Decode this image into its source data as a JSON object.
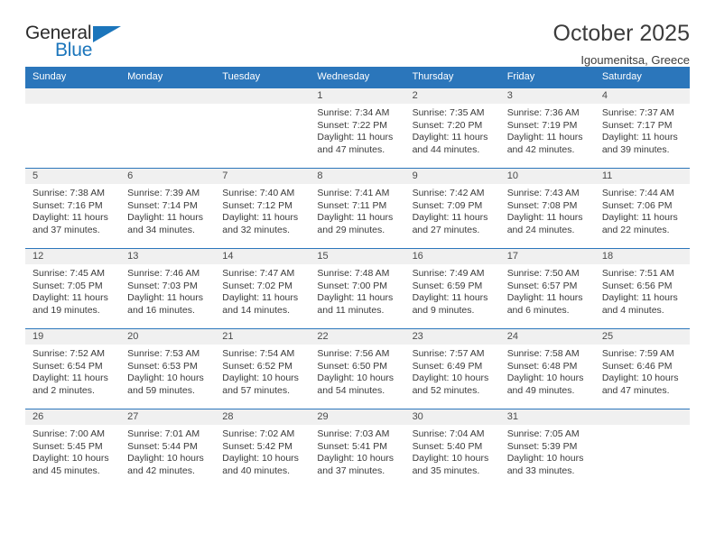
{
  "logo": {
    "word_top": "General",
    "word_bottom": "Blue",
    "accent_color": "#1b75bb"
  },
  "header": {
    "title": "October 2025",
    "subtitle": "Igoumenitsa, Greece"
  },
  "calendar": {
    "header_color": "#2b76bb",
    "weekdays": [
      "Sunday",
      "Monday",
      "Tuesday",
      "Wednesday",
      "Thursday",
      "Friday",
      "Saturday"
    ],
    "weeks": [
      [
        {
          "day": "",
          "sunrise": "",
          "sunset": "",
          "daylight": ""
        },
        {
          "day": "",
          "sunrise": "",
          "sunset": "",
          "daylight": ""
        },
        {
          "day": "",
          "sunrise": "",
          "sunset": "",
          "daylight": ""
        },
        {
          "day": "1",
          "sunrise": "Sunrise: 7:34 AM",
          "sunset": "Sunset: 7:22 PM",
          "daylight": "Daylight: 11 hours and 47 minutes."
        },
        {
          "day": "2",
          "sunrise": "Sunrise: 7:35 AM",
          "sunset": "Sunset: 7:20 PM",
          "daylight": "Daylight: 11 hours and 44 minutes."
        },
        {
          "day": "3",
          "sunrise": "Sunrise: 7:36 AM",
          "sunset": "Sunset: 7:19 PM",
          "daylight": "Daylight: 11 hours and 42 minutes."
        },
        {
          "day": "4",
          "sunrise": "Sunrise: 7:37 AM",
          "sunset": "Sunset: 7:17 PM",
          "daylight": "Daylight: 11 hours and 39 minutes."
        }
      ],
      [
        {
          "day": "5",
          "sunrise": "Sunrise: 7:38 AM",
          "sunset": "Sunset: 7:16 PM",
          "daylight": "Daylight: 11 hours and 37 minutes."
        },
        {
          "day": "6",
          "sunrise": "Sunrise: 7:39 AM",
          "sunset": "Sunset: 7:14 PM",
          "daylight": "Daylight: 11 hours and 34 minutes."
        },
        {
          "day": "7",
          "sunrise": "Sunrise: 7:40 AM",
          "sunset": "Sunset: 7:12 PM",
          "daylight": "Daylight: 11 hours and 32 minutes."
        },
        {
          "day": "8",
          "sunrise": "Sunrise: 7:41 AM",
          "sunset": "Sunset: 7:11 PM",
          "daylight": "Daylight: 11 hours and 29 minutes."
        },
        {
          "day": "9",
          "sunrise": "Sunrise: 7:42 AM",
          "sunset": "Sunset: 7:09 PM",
          "daylight": "Daylight: 11 hours and 27 minutes."
        },
        {
          "day": "10",
          "sunrise": "Sunrise: 7:43 AM",
          "sunset": "Sunset: 7:08 PM",
          "daylight": "Daylight: 11 hours and 24 minutes."
        },
        {
          "day": "11",
          "sunrise": "Sunrise: 7:44 AM",
          "sunset": "Sunset: 7:06 PM",
          "daylight": "Daylight: 11 hours and 22 minutes."
        }
      ],
      [
        {
          "day": "12",
          "sunrise": "Sunrise: 7:45 AM",
          "sunset": "Sunset: 7:05 PM",
          "daylight": "Daylight: 11 hours and 19 minutes."
        },
        {
          "day": "13",
          "sunrise": "Sunrise: 7:46 AM",
          "sunset": "Sunset: 7:03 PM",
          "daylight": "Daylight: 11 hours and 16 minutes."
        },
        {
          "day": "14",
          "sunrise": "Sunrise: 7:47 AM",
          "sunset": "Sunset: 7:02 PM",
          "daylight": "Daylight: 11 hours and 14 minutes."
        },
        {
          "day": "15",
          "sunrise": "Sunrise: 7:48 AM",
          "sunset": "Sunset: 7:00 PM",
          "daylight": "Daylight: 11 hours and 11 minutes."
        },
        {
          "day": "16",
          "sunrise": "Sunrise: 7:49 AM",
          "sunset": "Sunset: 6:59 PM",
          "daylight": "Daylight: 11 hours and 9 minutes."
        },
        {
          "day": "17",
          "sunrise": "Sunrise: 7:50 AM",
          "sunset": "Sunset: 6:57 PM",
          "daylight": "Daylight: 11 hours and 6 minutes."
        },
        {
          "day": "18",
          "sunrise": "Sunrise: 7:51 AM",
          "sunset": "Sunset: 6:56 PM",
          "daylight": "Daylight: 11 hours and 4 minutes."
        }
      ],
      [
        {
          "day": "19",
          "sunrise": "Sunrise: 7:52 AM",
          "sunset": "Sunset: 6:54 PM",
          "daylight": "Daylight: 11 hours and 2 minutes."
        },
        {
          "day": "20",
          "sunrise": "Sunrise: 7:53 AM",
          "sunset": "Sunset: 6:53 PM",
          "daylight": "Daylight: 10 hours and 59 minutes."
        },
        {
          "day": "21",
          "sunrise": "Sunrise: 7:54 AM",
          "sunset": "Sunset: 6:52 PM",
          "daylight": "Daylight: 10 hours and 57 minutes."
        },
        {
          "day": "22",
          "sunrise": "Sunrise: 7:56 AM",
          "sunset": "Sunset: 6:50 PM",
          "daylight": "Daylight: 10 hours and 54 minutes."
        },
        {
          "day": "23",
          "sunrise": "Sunrise: 7:57 AM",
          "sunset": "Sunset: 6:49 PM",
          "daylight": "Daylight: 10 hours and 52 minutes."
        },
        {
          "day": "24",
          "sunrise": "Sunrise: 7:58 AM",
          "sunset": "Sunset: 6:48 PM",
          "daylight": "Daylight: 10 hours and 49 minutes."
        },
        {
          "day": "25",
          "sunrise": "Sunrise: 7:59 AM",
          "sunset": "Sunset: 6:46 PM",
          "daylight": "Daylight: 10 hours and 47 minutes."
        }
      ],
      [
        {
          "day": "26",
          "sunrise": "Sunrise: 7:00 AM",
          "sunset": "Sunset: 5:45 PM",
          "daylight": "Daylight: 10 hours and 45 minutes."
        },
        {
          "day": "27",
          "sunrise": "Sunrise: 7:01 AM",
          "sunset": "Sunset: 5:44 PM",
          "daylight": "Daylight: 10 hours and 42 minutes."
        },
        {
          "day": "28",
          "sunrise": "Sunrise: 7:02 AM",
          "sunset": "Sunset: 5:42 PM",
          "daylight": "Daylight: 10 hours and 40 minutes."
        },
        {
          "day": "29",
          "sunrise": "Sunrise: 7:03 AM",
          "sunset": "Sunset: 5:41 PM",
          "daylight": "Daylight: 10 hours and 37 minutes."
        },
        {
          "day": "30",
          "sunrise": "Sunrise: 7:04 AM",
          "sunset": "Sunset: 5:40 PM",
          "daylight": "Daylight: 10 hours and 35 minutes."
        },
        {
          "day": "31",
          "sunrise": "Sunrise: 7:05 AM",
          "sunset": "Sunset: 5:39 PM",
          "daylight": "Daylight: 10 hours and 33 minutes."
        },
        {
          "day": "",
          "sunrise": "",
          "sunset": "",
          "daylight": ""
        }
      ]
    ]
  }
}
